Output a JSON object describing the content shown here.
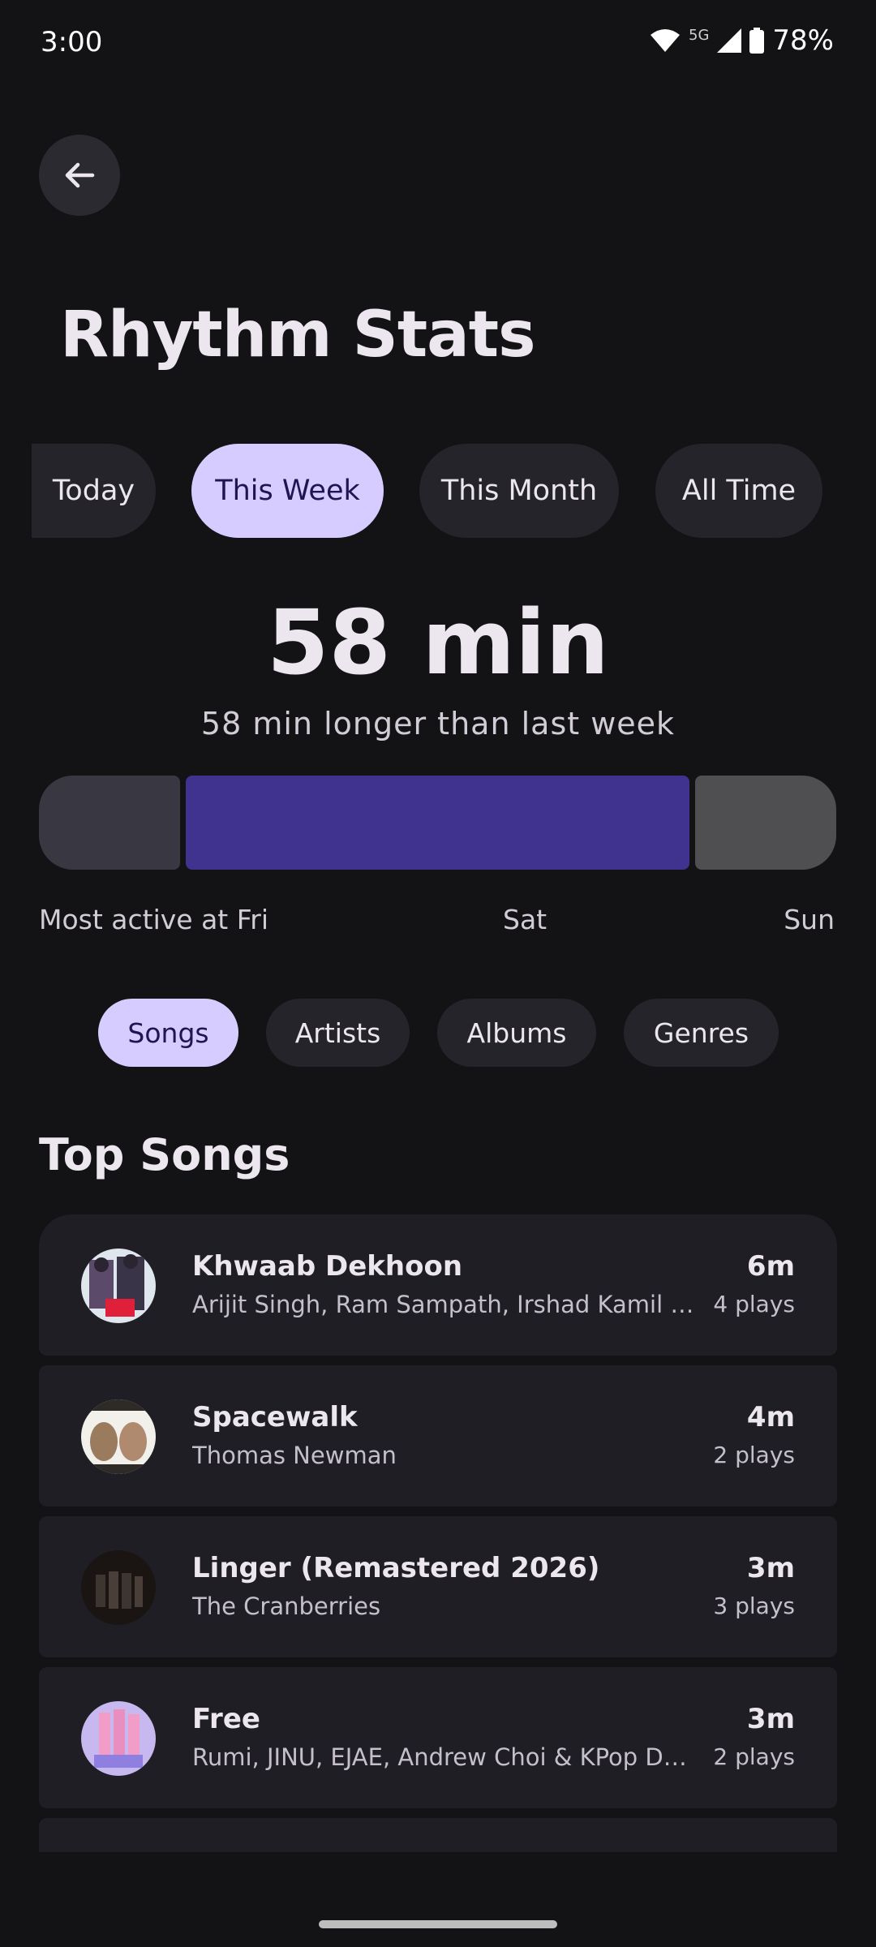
{
  "status_bar": {
    "time": "3:00",
    "network": "5G",
    "battery": "78%"
  },
  "header": {
    "back_icon": "arrow-left-icon",
    "title": "Rhythm Stats"
  },
  "period_tabs": [
    {
      "label": "Today",
      "active": false
    },
    {
      "label": "This Week",
      "active": true
    },
    {
      "label": "This Month",
      "active": false
    },
    {
      "label": "All Time",
      "active": false
    }
  ],
  "summary": {
    "total": "58 min",
    "comparison": "58 min longer than last week"
  },
  "activity": {
    "labels": [
      "Most active at Fri",
      "Sat",
      "Sun"
    ],
    "colors": {
      "inactive": "#393742",
      "peak": "#40338f",
      "other": "#4f4f52"
    }
  },
  "category_tabs": [
    {
      "label": "Songs",
      "active": true
    },
    {
      "label": "Artists",
      "active": false
    },
    {
      "label": "Albums",
      "active": false
    },
    {
      "label": "Genres",
      "active": false
    }
  ],
  "top_songs": {
    "title": "Top Songs",
    "items": [
      {
        "title": "Khwaab Dekhoon",
        "artist": "Arijit Singh, Ram Sampath, Irshad Kamil & ...",
        "duration": "6m",
        "plays": "4 plays"
      },
      {
        "title": "Spacewalk",
        "artist": "Thomas Newman",
        "duration": "4m",
        "plays": "2 plays"
      },
      {
        "title": "Linger (Remastered 2026)",
        "artist": "The Cranberries",
        "duration": "3m",
        "plays": "3 plays"
      },
      {
        "title": "Free",
        "artist": "Rumi, JINU, EJAE, Andrew Choi & KPop De...",
        "duration": "3m",
        "plays": "2 plays"
      }
    ]
  },
  "colors": {
    "accent": "#d7ccff",
    "background": "#131316",
    "card": "#1e1e24"
  }
}
